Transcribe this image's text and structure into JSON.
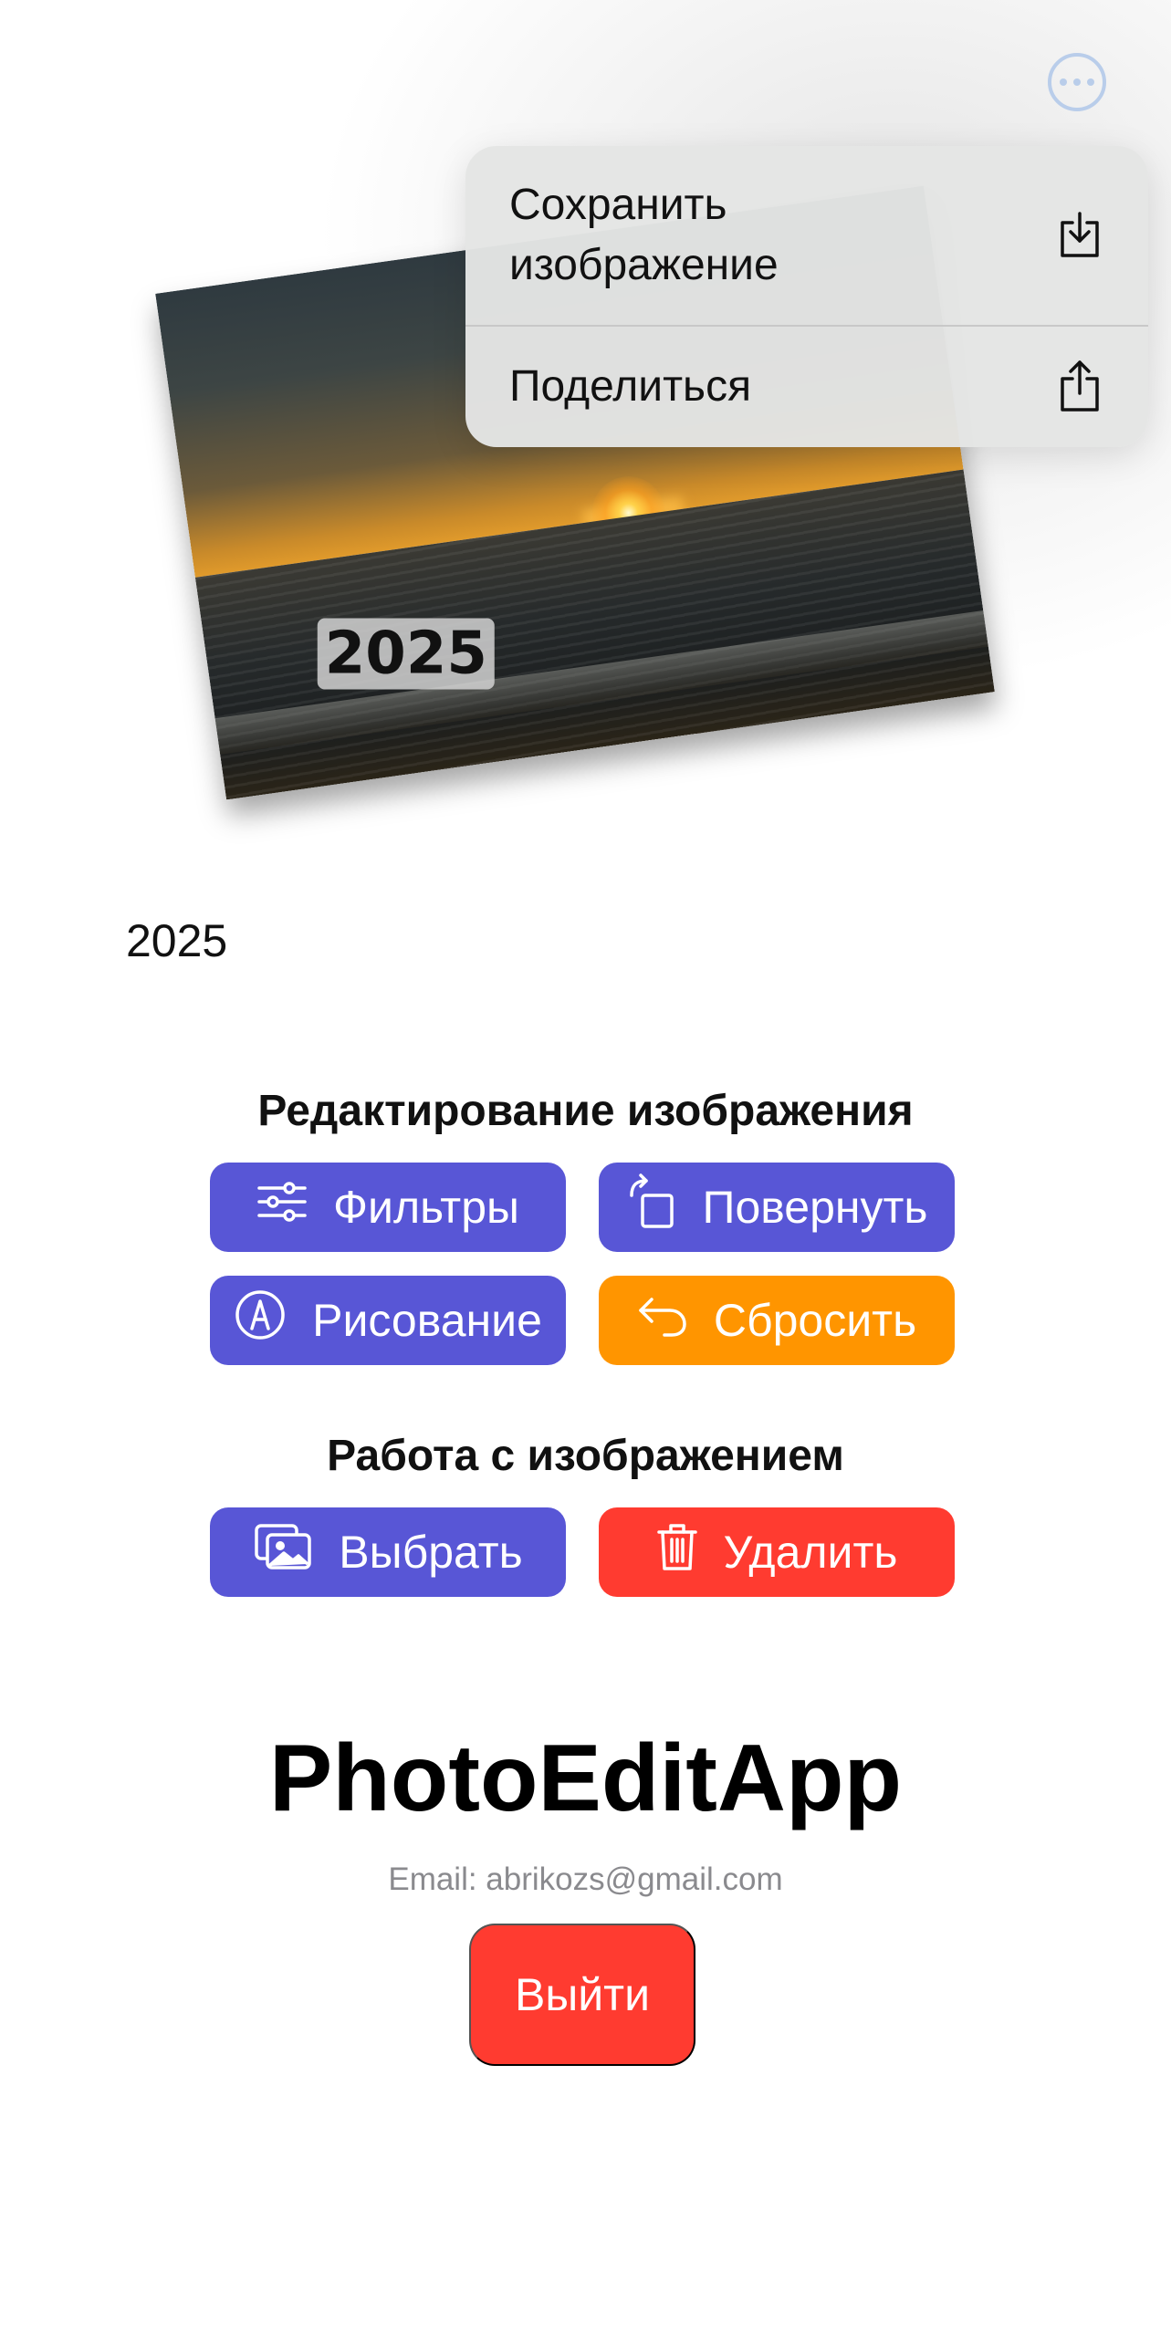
{
  "toolbar": {
    "more_icon": "ellipsis-circle-icon"
  },
  "photo": {
    "overlay_text": "2025",
    "caption": "2025"
  },
  "menu": {
    "items": [
      {
        "label": "Сохранить\nизображение",
        "icon": "save-download-icon"
      },
      {
        "label": "Поделиться",
        "icon": "share-icon"
      }
    ]
  },
  "edit_section": {
    "title": "Редактирование изображения",
    "buttons": [
      {
        "label": "Фильтры",
        "icon": "sliders-icon",
        "color": "#5856d6"
      },
      {
        "label": "Повернуть",
        "icon": "rotate-icon",
        "color": "#5856d6"
      },
      {
        "label": "Рисование",
        "icon": "pencil-circle-icon",
        "color": "#5856d6"
      },
      {
        "label": "Сбросить",
        "icon": "undo-icon",
        "color": "#ff9500"
      }
    ]
  },
  "image_section": {
    "title": "Работа с изображением",
    "buttons": [
      {
        "label": "Выбрать",
        "icon": "photo-stack-icon",
        "color": "#5856d6"
      },
      {
        "label": "Удалить",
        "icon": "trash-icon",
        "color": "#ff3b30"
      }
    ]
  },
  "footer": {
    "app_name": "PhotoEditApp",
    "email": "Email: abrikozs@gmail.com",
    "logout_label": "Выйти",
    "logout_color": "#ff3b30"
  }
}
